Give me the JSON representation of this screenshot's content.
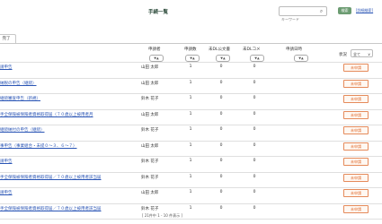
{
  "header": {
    "title": "手続一覧",
    "search_placeholder": "キーワード",
    "search_button": "検索",
    "detail_link": "[詳細検索]"
  },
  "tabs": [
    {
      "label": "完了"
    }
  ],
  "columns": {
    "applicant": "申請者",
    "request_count": "申請数",
    "unread_docs": "未DL公文書",
    "unread_comments": "未DLコメ",
    "apply_date": "申請日時",
    "status": "状況",
    "status_filter": "全て"
  },
  "sort_label": "▼▲",
  "rows": [
    {
      "name": "請申告",
      "applicant": "山田 太郎",
      "count": "1",
      "docs": "0",
      "comments": "0",
      "status": "未申請"
    },
    {
      "name": "納税の申告（継続）",
      "applicant": "山田 太郎",
      "count": "1",
      "docs": "0",
      "comments": "0",
      "status": "未申請"
    },
    {
      "name": "継続審査申告（新規）",
      "applicant": "鈴木 花子",
      "count": "1",
      "docs": "0",
      "comments": "0",
      "status": "未申請"
    },
    {
      "name": "手全保険被保険者資格取得届（７０歳以上被用者月",
      "applicant": "山田 太郎",
      "count": "1",
      "docs": "0",
      "comments": "0",
      "status": "未申請"
    },
    {
      "name": "継続納付の申告（継続）",
      "applicant": "鈴木 花子",
      "count": "1",
      "docs": "0",
      "comments": "0",
      "status": "未申請"
    },
    {
      "name": "事申告（事業組合・未提０～３、６～７）",
      "applicant": "山田 太郎",
      "count": "1",
      "docs": "0",
      "comments": "0",
      "status": "未申請"
    },
    {
      "name": "請申告",
      "applicant": "鈴木 花子",
      "count": "1",
      "docs": "0",
      "comments": "0",
      "status": "未申請"
    },
    {
      "name": "手全保険被保険者資格取得届／７０歳以上被用者該当届",
      "applicant": "鈴木 花子",
      "count": "1",
      "docs": "0",
      "comments": "0",
      "status": "未申請"
    },
    {
      "name": "請申告",
      "applicant": "山田 太郎",
      "count": "1",
      "docs": "0",
      "comments": "0",
      "status": "未申請"
    },
    {
      "name": "手全保険被保険者資格取得届／７０歳以上被用者該当届",
      "applicant": "鈴木 花子",
      "count": "1",
      "docs": "0",
      "comments": "0",
      "status": "未申請"
    }
  ],
  "footer": "[ 21件中 1 - 10 件表示 ]"
}
